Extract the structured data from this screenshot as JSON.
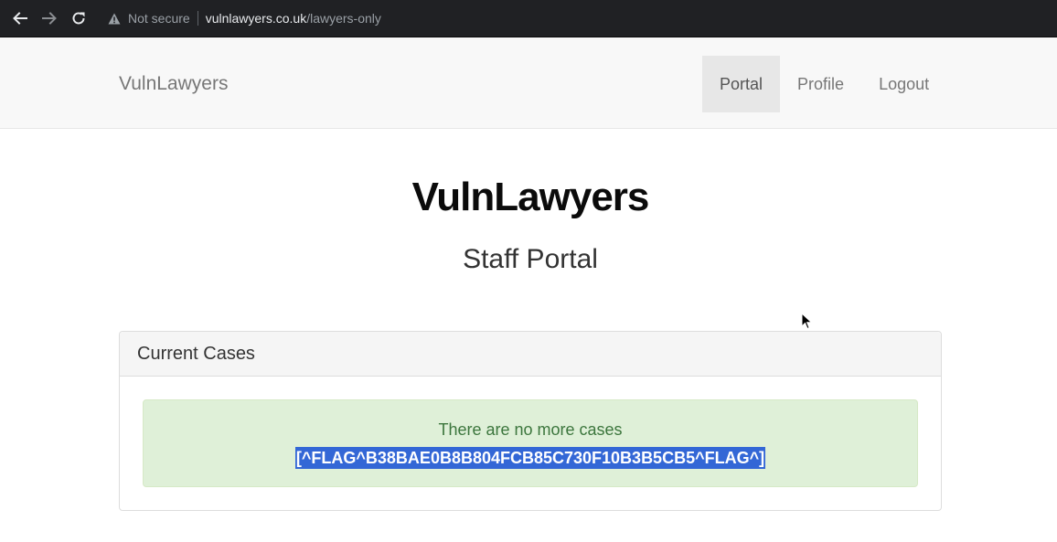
{
  "browser": {
    "security_label": "Not secure",
    "url_domain": "vulnlawyers.co.uk",
    "url_path": "/lawyers-only"
  },
  "navbar": {
    "brand": "VulnLawyers",
    "links": [
      {
        "label": "Portal",
        "active": true
      },
      {
        "label": "Profile",
        "active": false
      },
      {
        "label": "Logout",
        "active": false
      }
    ]
  },
  "main": {
    "title": "VulnLawyers",
    "subtitle": "Staff Portal"
  },
  "panel": {
    "heading": "Current Cases",
    "alert_message": "There are no more cases",
    "flag_text": "[^FLAG^B38BAE0B8B804FCB85C730F10B3B5CB5^FLAG^]"
  },
  "colors": {
    "chrome_bg": "#202124",
    "navbar_bg": "#f8f8f8",
    "active_link_bg": "#e7e7e7",
    "alert_bg": "#dff0d8",
    "alert_text": "#3c763d",
    "selection_bg": "#3367d6"
  },
  "icons": [
    "back-arrow-icon",
    "forward-arrow-icon",
    "reload-icon",
    "warning-icon",
    "mouse-cursor-icon"
  ]
}
